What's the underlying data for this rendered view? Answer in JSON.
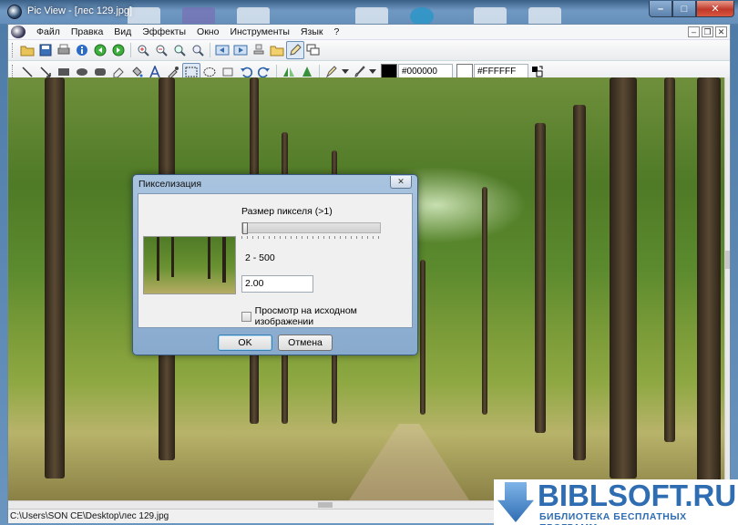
{
  "window": {
    "title": "Pic View - [лес 129.jpg]",
    "minimize": "–",
    "maximize": "□",
    "close": "✕"
  },
  "menubar": {
    "items": [
      "Файл",
      "Правка",
      "Вид",
      "Эффекты",
      "Окно",
      "Инструменты",
      "Язык",
      "?"
    ],
    "mdi_minimize": "–",
    "mdi_restore": "❐",
    "mdi_close": "✕"
  },
  "toolbar1": {
    "icons": [
      "open-folder-icon",
      "save-icon",
      "print-icon",
      "info-icon",
      "back-icon",
      "forward-icon",
      "zoom-in-icon",
      "zoom-out-icon",
      "zoom-fit-icon",
      "zoom-actual-icon",
      "prev-image-icon",
      "next-image-icon",
      "stamp-icon",
      "folder-icon",
      "edit-icon",
      "windows-icon"
    ]
  },
  "toolbar2": {
    "foreground_color_value": "#000000",
    "background_color_value": "#FFFFFF",
    "foreground_color": "#000000",
    "background_color": "#FFFFFF"
  },
  "dialog": {
    "title": "Пикселизация",
    "close": "✕",
    "pixel_size_label": "Размер пикселя (>1)",
    "range_label": "2 - 500",
    "value": "2.00",
    "slider_fraction": 0.0,
    "preview_checkbox_label": "Просмотр на исходном изображении",
    "preview_checked": false,
    "ok_label": "OK",
    "cancel_label": "Отмена"
  },
  "statusbar": {
    "path": "C:\\Users\\SON CE\\Desktop\\лес 129.jpg"
  },
  "watermark": {
    "title": "BIBLSOFT.RU",
    "subtitle": "БИБЛИОТЕКА БЕСПЛАТНЫХ ПРОГРАММ"
  },
  "colors": {
    "accent": "#2f6db3",
    "titlebar": "#6690bb"
  }
}
